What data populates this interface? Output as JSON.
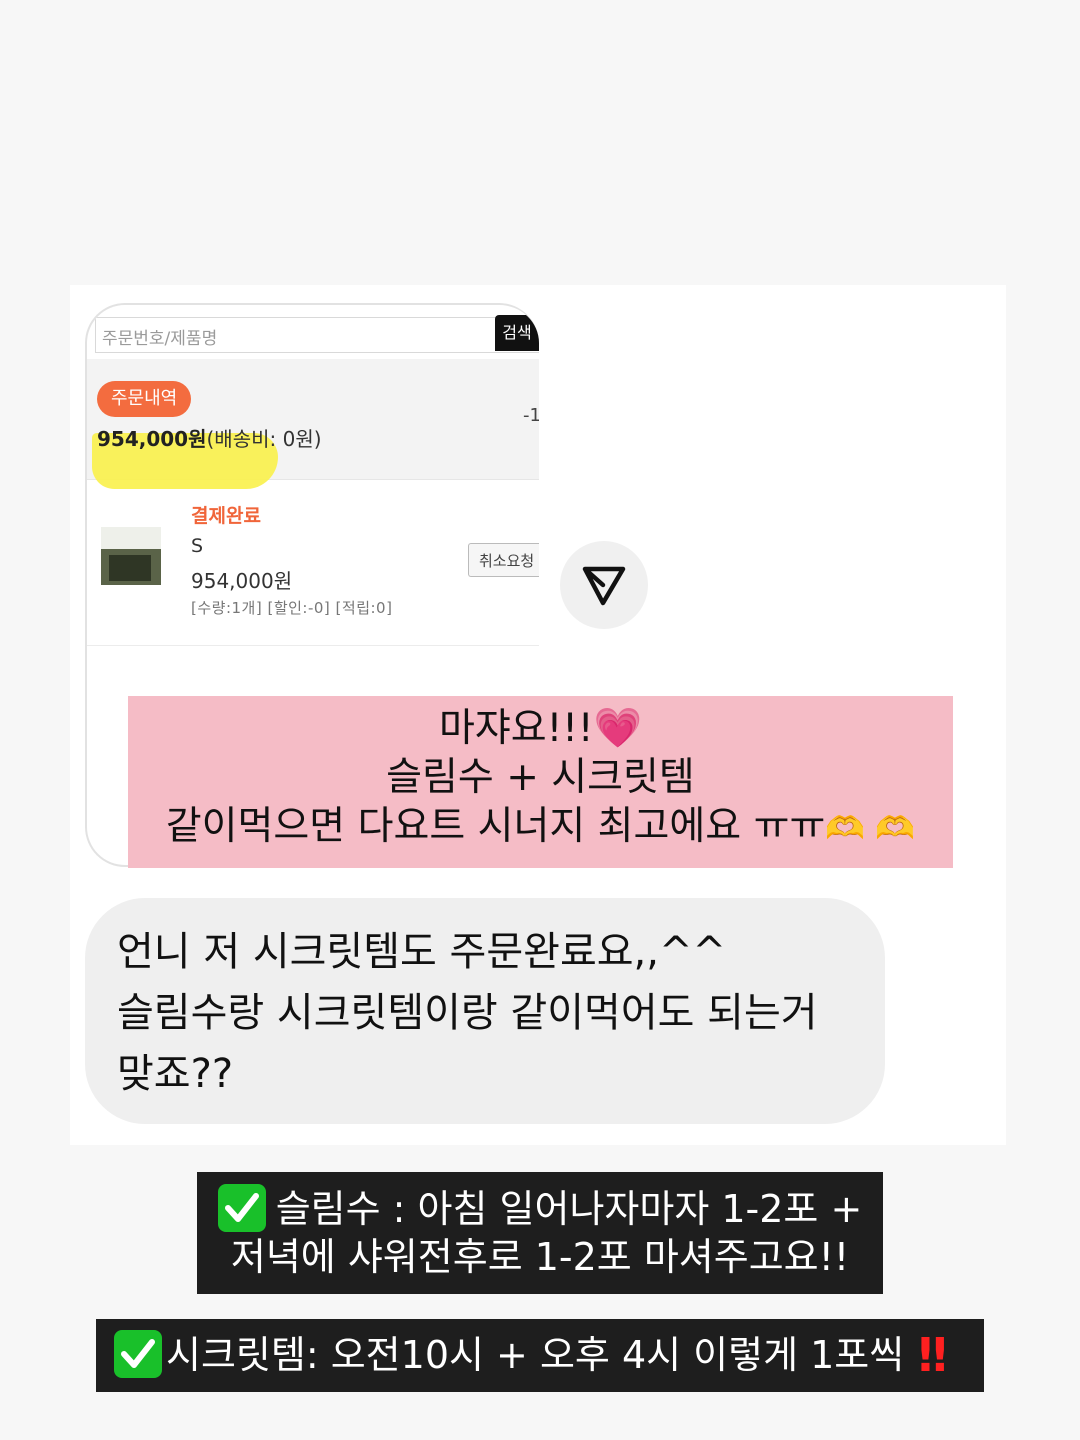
{
  "order_screenshot": {
    "search_placeholder": "주문번호/제품명",
    "search_button": "검색",
    "order_badge": "주문내역",
    "order_total": "954,000원",
    "shipping": "(배송비: 0원)",
    "dash": "-1",
    "payment_status": "결제완료",
    "product_name": "S",
    "product_price": "954,000원",
    "product_meta": "[수량:1개] [할인:-0] [적립:0]",
    "cancel_button": "취소요청"
  },
  "share_icon": "send-icon",
  "pink_message": {
    "line1": "마쟈요!!!",
    "line1_emoji": "💗",
    "line2": "슬림수 + 시크릿템",
    "line3": "같이먹으면 다요트 시너지 최고에요 ㅠㅠ",
    "line3_emoji": "🫶 🫶"
  },
  "chat_bubble": {
    "line1": "언니 저 시크릿템도 주문완료요,,^^",
    "line2": "슬림수랑 시크릿템이랑 같이먹어도 되는거",
    "line3": "맞죠??"
  },
  "instruction1": {
    "line1": "슬림수 : 아침 일어나자마자 1-2포 +",
    "line2": "저녁에 샤워전후로 1-2포 마셔주고요!!"
  },
  "instruction2": {
    "text": "시크릿템: 오전10시 + 오후 4시 이렇게 1포씩",
    "bang": "‼"
  },
  "colors": {
    "pink_box": "#f5bcc6",
    "dark_box": "#1e1e1e",
    "order_badge": "#f36c3f",
    "highlight": "#f9f14a",
    "check_green": "#19c02a"
  }
}
